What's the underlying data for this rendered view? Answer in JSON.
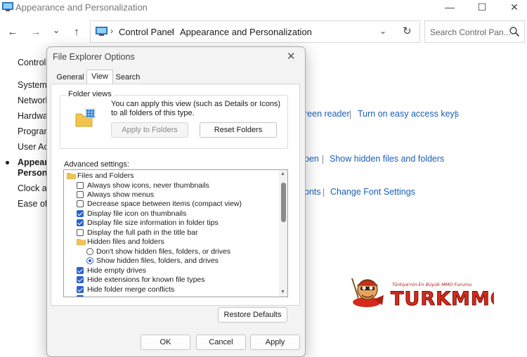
{
  "window": {
    "title": "Appearance and Personalization",
    "minimize": "—",
    "maximize": "☐",
    "close": "✕"
  },
  "nav": {
    "back": "←",
    "forward": "→",
    "recent": "⌄",
    "up": "↑"
  },
  "address": {
    "sep1": "›",
    "crumb1": "Control Panel",
    "sep2": "›",
    "crumb2": "Appearance and Personalization",
    "dropdown": "⌄",
    "refresh": "↻"
  },
  "search": {
    "placeholder": "Search Control Pan..."
  },
  "left_nav": [
    "Control",
    "System a",
    "Network",
    "Hardwa",
    "Program",
    "User Acc",
    "Appeara",
    "Persona",
    "Clock ar",
    "Ease of A"
  ],
  "background_links": {
    "screen_reader": "reen reader",
    "easy_access_keys": "Turn on easy access keys",
    "open": "pen",
    "hidden_files": "Show hidden files and folders",
    "fonts": "onts",
    "font_settings": "Change Font Settings"
  },
  "dialog": {
    "title": "File Explorer Options",
    "close": "✕",
    "tabs": [
      "General",
      "View",
      "Search"
    ],
    "active_tab": "View",
    "folder_views": {
      "title": "Folder views",
      "description": "You can apply this view (such as Details or Icons) to all folders of this type.",
      "apply_button": "Apply to Folders",
      "reset_button": "Reset Folders"
    },
    "advanced_label": "Advanced settings:",
    "tree": [
      {
        "type": "folder",
        "label": "Files and Folders"
      },
      {
        "type": "checkbox",
        "label": "Always show icons, never thumbnails",
        "checked": false
      },
      {
        "type": "checkbox",
        "label": "Always show menus",
        "checked": false
      },
      {
        "type": "checkbox",
        "label": "Decrease space between items (compact view)",
        "checked": false
      },
      {
        "type": "checkbox",
        "label": "Display file icon on thumbnails",
        "checked": true
      },
      {
        "type": "checkbox",
        "label": "Display file size information in folder tips",
        "checked": true
      },
      {
        "type": "checkbox",
        "label": "Display the full path in the title bar",
        "checked": false
      },
      {
        "type": "folder",
        "label": "Hidden files and folders"
      },
      {
        "type": "radio",
        "label": "Don't show hidden files, folders, or drives",
        "selected": false
      },
      {
        "type": "radio",
        "label": "Show hidden files, folders, and drives",
        "selected": true
      },
      {
        "type": "checkbox",
        "label": "Hide empty drives",
        "checked": true
      },
      {
        "type": "checkbox",
        "label": "Hide extensions for known file types",
        "checked": true
      },
      {
        "type": "checkbox",
        "label": "Hide folder merge conflicts",
        "checked": true
      },
      {
        "type": "checkbox",
        "label": "",
        "checked": true
      }
    ],
    "restore_button": "Restore Defaults",
    "ok_button": "OK",
    "cancel_button": "Cancel",
    "apply_button": "Apply"
  },
  "logo": {
    "tagline": "Türkiye'nin En Büyük MMO Forumu",
    "brand": "TURKMMO"
  },
  "colors": {
    "link": "#1a5fb4",
    "accent": "#2a62c9",
    "dialog_bg": "#f3f3f3",
    "logo_red": "#d42a1c",
    "logo_orange": "#f0a020"
  }
}
